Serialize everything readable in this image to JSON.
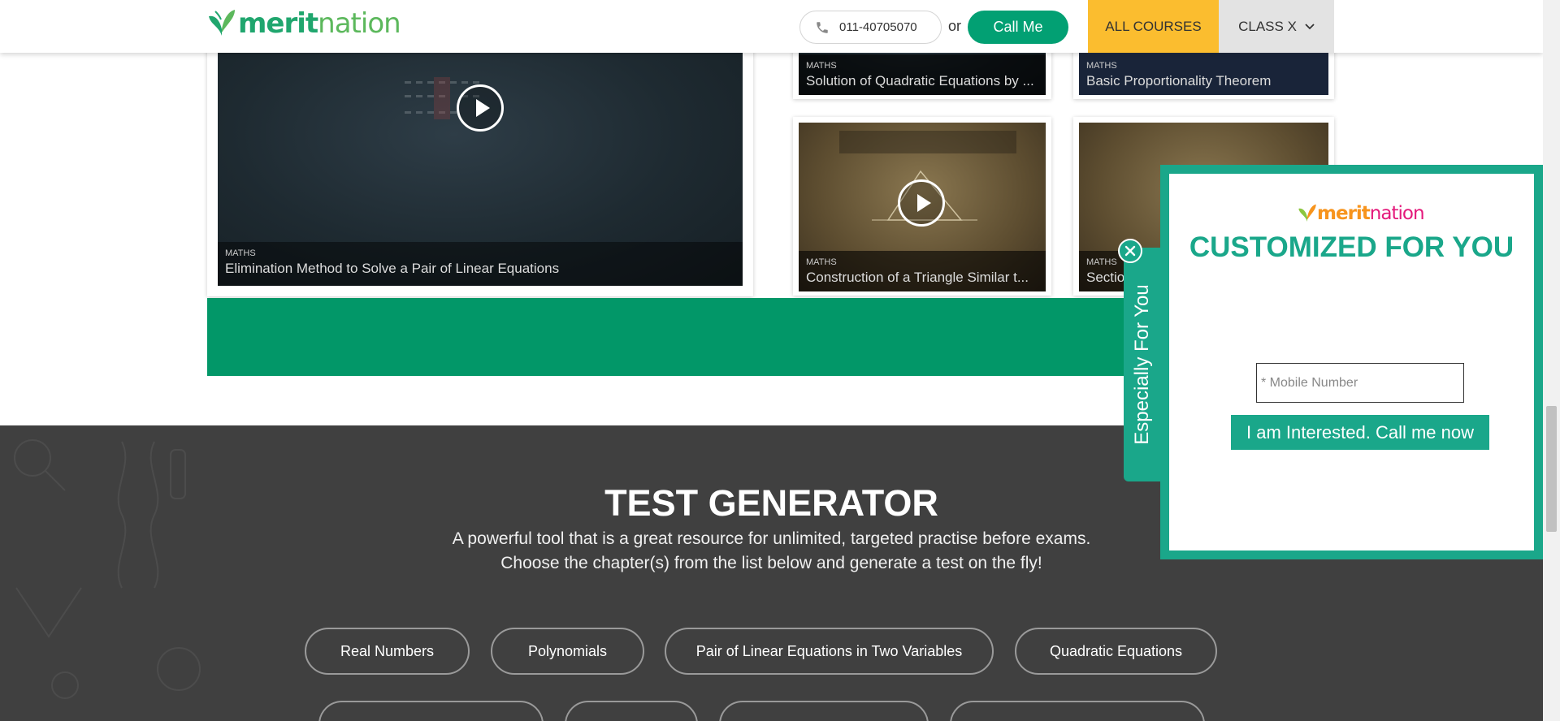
{
  "header": {
    "logo_text_a": "merit",
    "logo_text_b": "nation",
    "phone": "011-40705070",
    "or_label": "or",
    "call_button": "Call Me",
    "all_courses": "ALL COURSES",
    "class_label": "CLASS X"
  },
  "videos": {
    "main": {
      "subject": "MATHS",
      "title": "Elimination Method to Solve a Pair of Linear Equations"
    },
    "top_left": {
      "subject": "MATHS",
      "title": "Solution of Quadratic Equations by ..."
    },
    "top_right": {
      "subject": "MATHS",
      "title": "Basic Proportionality Theorem"
    },
    "bottom_left": {
      "subject": "MATHS",
      "title": "Construction of a Triangle Similar t..."
    },
    "bottom_right": {
      "subject": "MATHS",
      "title": "Sectio"
    }
  },
  "test_generator": {
    "title": "TEST GENERATOR",
    "desc_line1": "A powerful tool that is a great resource for unlimited, targeted practise before exams.",
    "desc_line2": "Choose the chapter(s) from the list below and generate a test on the fly!",
    "chapters": [
      "Real Numbers",
      "Polynomials",
      "Pair of Linear Equations in Two Variables",
      "Quadratic Equations"
    ]
  },
  "popup": {
    "tab_label": "Especially For You",
    "logo_text_a": "merit",
    "logo_text_b": "nation",
    "title": "CUSTOMIZED FOR YOU",
    "mobile_placeholder": "* Mobile Number",
    "submit_button": "I am Interested. Call me now"
  },
  "colors": {
    "brand_green": "#02a073",
    "popup_teal": "#1aa78a",
    "courses_yellow": "#fbbd2f",
    "dark_section": "#404040"
  }
}
